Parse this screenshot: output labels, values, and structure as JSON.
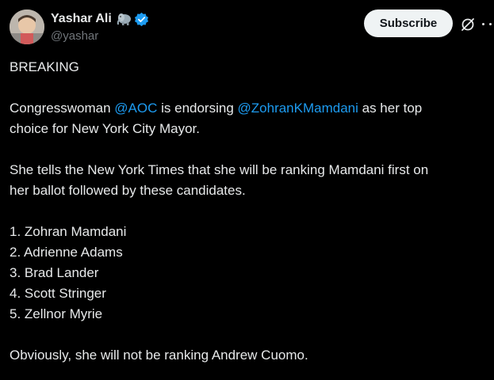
{
  "author": {
    "display_name": "Yashar Ali",
    "handle": "@yashar",
    "emoji_icon": "elephant-emoji-icon",
    "verified_icon": "verified-badge-icon",
    "verified_color": "#1d9bf0"
  },
  "actions": {
    "subscribe_label": "Subscribe",
    "grok_icon": "grok-icon",
    "more_icon": "more-options-icon"
  },
  "post": {
    "headline": "BREAKING",
    "p1": {
      "pre": "Congresswoman ",
      "mention1": "@AOC",
      "mid": " is endorsing ",
      "mention2": "@ZohranKMamdani",
      "post_line1": " as her top",
      "line2": "choice for New York City Mayor."
    },
    "p2": {
      "line1": "She tells the New York Times that she will be ranking Mamdani first on",
      "line2": "her ballot followed by these candidates."
    },
    "list": [
      "1. Zohran Mamdani",
      "2. Adrienne Adams",
      "3. Brad Lander",
      "4. Scott Stringer",
      "5. Zellnor Myrie"
    ],
    "closing": "Obviously, she will not be ranking Andrew Cuomo."
  },
  "colors": {
    "background": "#000000",
    "text": "#e7e9ea",
    "muted": "#71767b",
    "link": "#1d9bf0",
    "button_bg": "#eff3f4"
  }
}
